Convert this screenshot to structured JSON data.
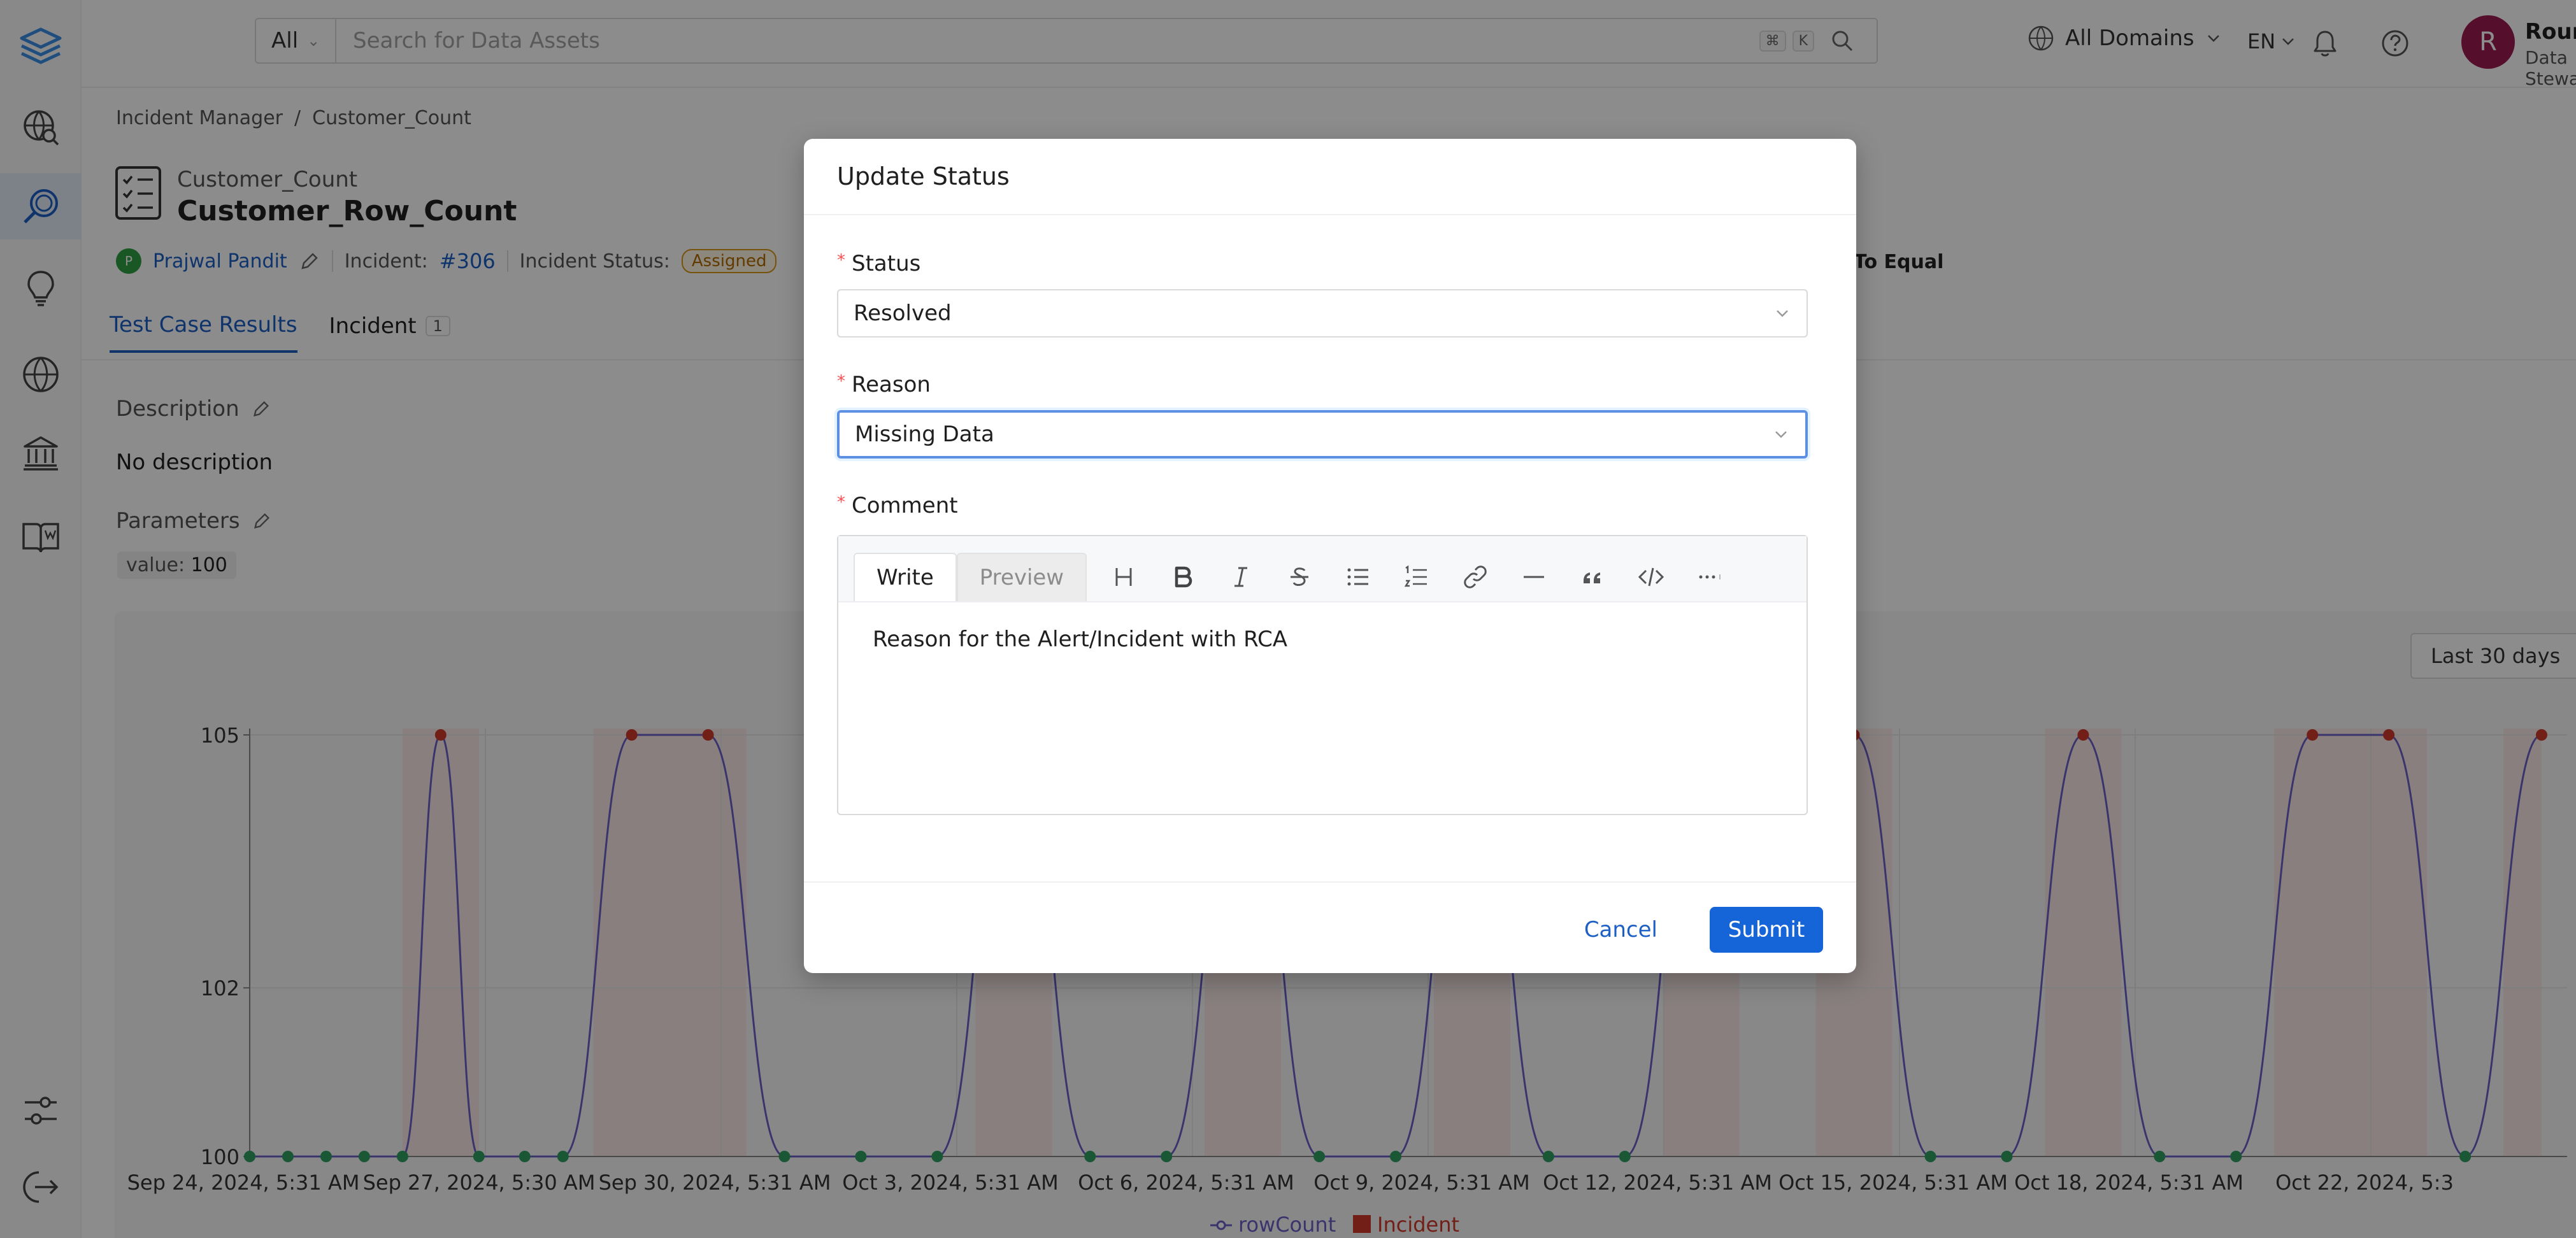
{
  "header": {
    "search_type": "All",
    "search_placeholder": "Search for Data Assets",
    "kbd_cmd": "⌘",
    "kbd_k": "K",
    "domains_label": "All Domains",
    "language": "EN",
    "user_initial": "R",
    "user_name": "Rounakpreet.",
    "user_role": "Data Steward"
  },
  "breadcrumb": {
    "items": [
      "Incident Manager",
      "/",
      "Customer_Count"
    ]
  },
  "entity": {
    "subtitle": "Customer_Count",
    "title": "Customer_Row_Count",
    "owner_initial": "P",
    "owner": "Prajwal Pandit",
    "incident_label": "Incident:",
    "incident_id": "#306",
    "status_label": "Incident Status:",
    "status": "Assigned",
    "right_text": "To Equal"
  },
  "tabs": [
    {
      "label": "Test Case Results"
    },
    {
      "label": "Incident",
      "count": "1"
    }
  ],
  "details": {
    "description_label": "Description",
    "description_value": "No description",
    "parameters_label": "Parameters",
    "param_key": "value:",
    "param_value": "100",
    "range_label": "Last 30 days"
  },
  "chart_data": {
    "type": "line",
    "series": [
      {
        "name": "rowCount"
      },
      {
        "name": "Incident"
      }
    ],
    "x_ticks": [
      "Sep 24, 2024, 5:31 AM",
      "Sep 27, 2024, 5:30 AM",
      "Sep 30, 2024, 5:31 AM",
      "Oct 3, 2024, 5:31 AM",
      "Oct 6, 2024, 5:31 AM",
      "Oct 9, 2024, 5:31 AM",
      "Oct 12, 2024, 5:31 AM",
      "Oct 15, 2024, 5:31 AM",
      "Oct 18, 2024, 5:31 AM",
      "Oct 22, 2024, 5:3"
    ],
    "y_ticks": [
      "105",
      "102",
      "100"
    ],
    "ylim": [
      100,
      105
    ],
    "points": [
      {
        "d": 0,
        "v": 100
      },
      {
        "d": 0.5,
        "v": 100
      },
      {
        "d": 1,
        "v": 100
      },
      {
        "d": 1.5,
        "v": 100
      },
      {
        "d": 2,
        "v": 100
      },
      {
        "d": 2.5,
        "v": 105
      },
      {
        "d": 3,
        "v": 100
      },
      {
        "d": 3.6,
        "v": 100
      },
      {
        "d": 4.1,
        "v": 100
      },
      {
        "d": 5,
        "v": 105
      },
      {
        "d": 6,
        "v": 105
      },
      {
        "d": 7,
        "v": 100
      },
      {
        "d": 8,
        "v": 100
      },
      {
        "d": 9,
        "v": 100
      },
      {
        "d": 10,
        "v": 105
      },
      {
        "d": 11,
        "v": 100
      },
      {
        "d": 12,
        "v": 100
      },
      {
        "d": 13,
        "v": 105
      },
      {
        "d": 14,
        "v": 100
      },
      {
        "d": 15,
        "v": 100
      },
      {
        "d": 16,
        "v": 105
      },
      {
        "d": 17,
        "v": 100
      },
      {
        "d": 18,
        "v": 100
      },
      {
        "d": 19,
        "v": 105
      },
      {
        "d": 21,
        "v": 105
      },
      {
        "d": 22,
        "v": 100
      },
      {
        "d": 23,
        "v": 100
      },
      {
        "d": 24,
        "v": 105
      },
      {
        "d": 25,
        "v": 100
      },
      {
        "d": 26,
        "v": 100
      },
      {
        "d": 27,
        "v": 105
      },
      {
        "d": 28,
        "v": 105
      },
      {
        "d": 29,
        "v": 100
      },
      {
        "d": 30,
        "v": 105
      }
    ],
    "colors": {
      "line": "#6b5fc7",
      "pass": "#2e9e62",
      "fail": "#d03a2a",
      "incident": "#d03a2a"
    }
  },
  "modal": {
    "title": "Update Status",
    "status_label": "Status",
    "status_value": "Resolved",
    "reason_label": "Reason",
    "reason_value": "Missing Data",
    "comment_label": "Comment",
    "write_tab": "Write",
    "preview_tab": "Preview",
    "comment_text": "Reason for the Alert/Incident with RCA",
    "cancel_label": "Cancel",
    "submit_label": "Submit"
  }
}
